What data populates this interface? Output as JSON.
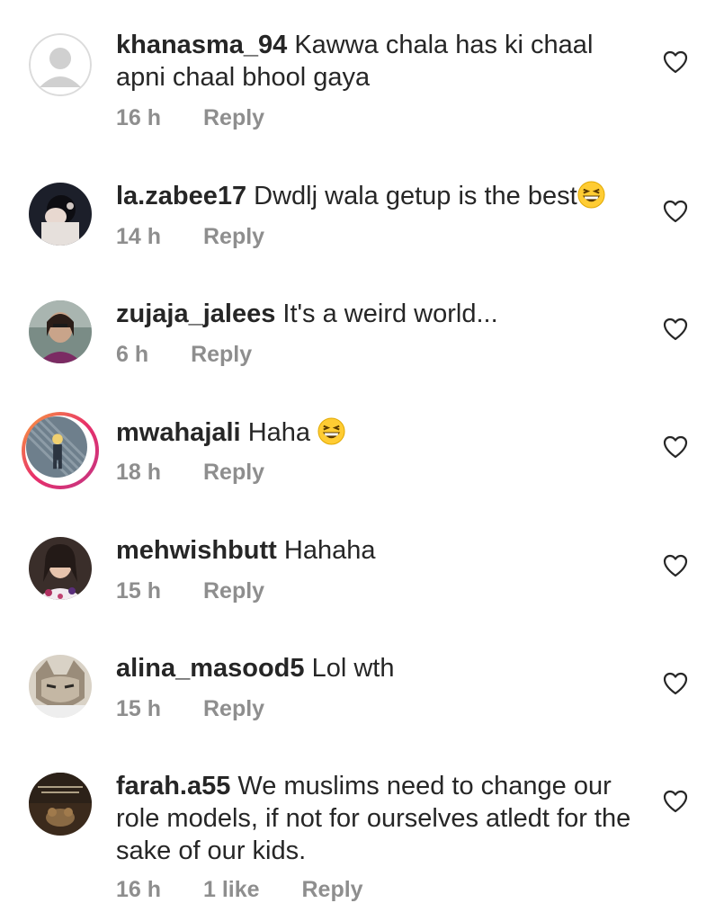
{
  "comments": [
    {
      "username": "khanasma_94",
      "text": "Kawwa  chala has ki chaal apni chaal bhool gaya",
      "time": "16 h",
      "likes": "",
      "reply": "Reply",
      "avatar_icon": "default-avatar-icon"
    },
    {
      "username": "la.zabee17",
      "text": "Dwdlj wala getup is the best",
      "time": "14 h",
      "likes": "",
      "reply": "Reply",
      "emoji": "grinning-squint-emoji"
    },
    {
      "username": "zujaja_jalees",
      "text": "It's a weird world...",
      "time": "6 h",
      "likes": "",
      "reply": "Reply"
    },
    {
      "username": "mwahajali",
      "text": "Haha",
      "time": "18 h",
      "likes": "",
      "reply": "Reply",
      "emoji": "grinning-squint-emoji",
      "story_ring": true
    },
    {
      "username": "mehwishbutt",
      "text": "Hahaha",
      "time": "15 h",
      "likes": "",
      "reply": "Reply"
    },
    {
      "username": "alina_masood5",
      "text": "Lol wth",
      "time": "15 h",
      "likes": "",
      "reply": "Reply"
    },
    {
      "username": "farah.a55",
      "text": "We muslims need to change our role models, if not for ourselves atledt for the sake of our kids.",
      "time": "16 h",
      "likes": "1 like",
      "reply": "Reply"
    }
  ],
  "colors": {
    "text": "#262626",
    "meta": "#8e8e8e",
    "heart_outline": "#262626",
    "story_ring": [
      "#f9a23b",
      "#e8306a",
      "#c13584"
    ]
  }
}
